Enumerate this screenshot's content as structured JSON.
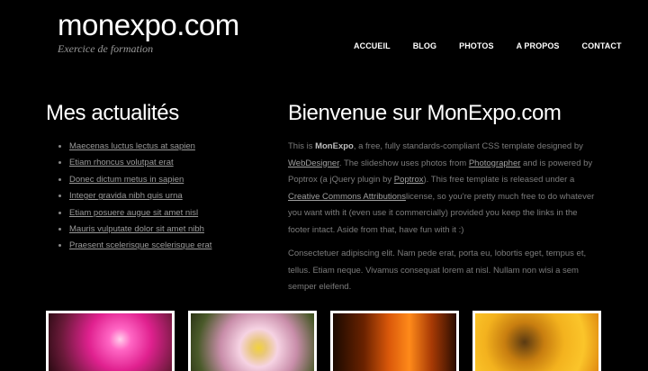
{
  "header": {
    "site_title": "monexpo.com",
    "tagline": "Exercice de formation",
    "nav": [
      "ACCUEIL",
      "BLOG",
      "PHOTOS",
      "A PROPOS",
      "CONTACT"
    ]
  },
  "news": {
    "title": "Mes actualités",
    "items": [
      "Maecenas luctus lectus at sapien",
      "Etiam rhoncus volutpat erat",
      "Donec dictum metus in sapien",
      "Integer gravida nibh quis urna",
      "Etiam posuere augue sit amet nisl",
      "Mauris vulputate dolor sit amet nibh",
      "Praesent scelerisque scelerisque erat"
    ]
  },
  "welcome": {
    "title": "Bienvenue sur MonExpo.com",
    "p1_a": "This is ",
    "p1_brand": "MonExpo",
    "p1_b": ", a free, fully standards-compliant CSS template designed by ",
    "p1_link1": "WebDesigner",
    "p1_c": ". The slideshow uses photos from ",
    "p1_link2": "Photographer",
    "p1_d": " and is powered by Poptrox (a jQuery plugin by ",
    "p1_link3": "Poptrox",
    "p1_e": "). This free template is released under a ",
    "p1_link4": "Creative Commons Attributions",
    "p1_f": "license, so you're pretty much free to do whatever you want with it (even use it commercially) provided you keep the links in the footer intact. Aside from that, have fun with it :)",
    "p2": "Consectetuer adipiscing elit. Nam pede erat, porta eu, lobortis eget, tempus et, tellus. Etiam neque. Vivamus consequat lorem at nisl. Nullam non wisi a sem semper eleifend."
  },
  "gallery": {
    "photos": [
      "hibiscus-photo",
      "water-lily-photo",
      "lily-stamens-photo",
      "insect-on-flower-photo"
    ]
  }
}
